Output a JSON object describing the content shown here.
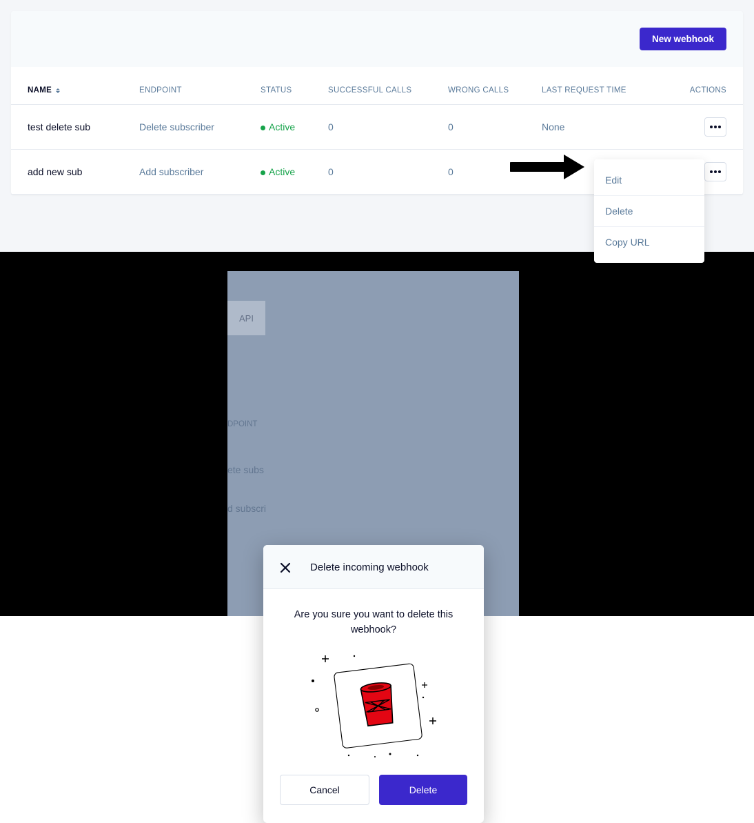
{
  "header": {
    "new_webhook_label": "New webhook"
  },
  "table": {
    "columns": {
      "name": "NAME",
      "endpoint": "ENDPOINT",
      "status": "STATUS",
      "success": "SUCCESSFUL CALLS",
      "wrong": "WRONG CALLS",
      "time": "LAST REQUEST TIME",
      "actions": "ACTIONS"
    },
    "rows": [
      {
        "name": "test delete sub",
        "endpoint": "Delete subscriber",
        "status": "Active",
        "success": "0",
        "wrong": "0",
        "time": "None"
      },
      {
        "name": "add new sub",
        "endpoint": "Add subscriber",
        "status": "Active",
        "success": "0",
        "wrong": "0",
        "time": ""
      }
    ]
  },
  "dropdown": {
    "edit": "Edit",
    "delete": "Delete",
    "copy_url": "Copy URL"
  },
  "background": {
    "tab": "API",
    "col_endpoint": "DPOINT",
    "row1_endpoint": "ete subs",
    "row2_endpoint": "d subscri"
  },
  "modal": {
    "title": "Delete incoming webhook",
    "text": "Are you sure you want to delete this webhook?",
    "cancel": "Cancel",
    "delete": "Delete"
  }
}
